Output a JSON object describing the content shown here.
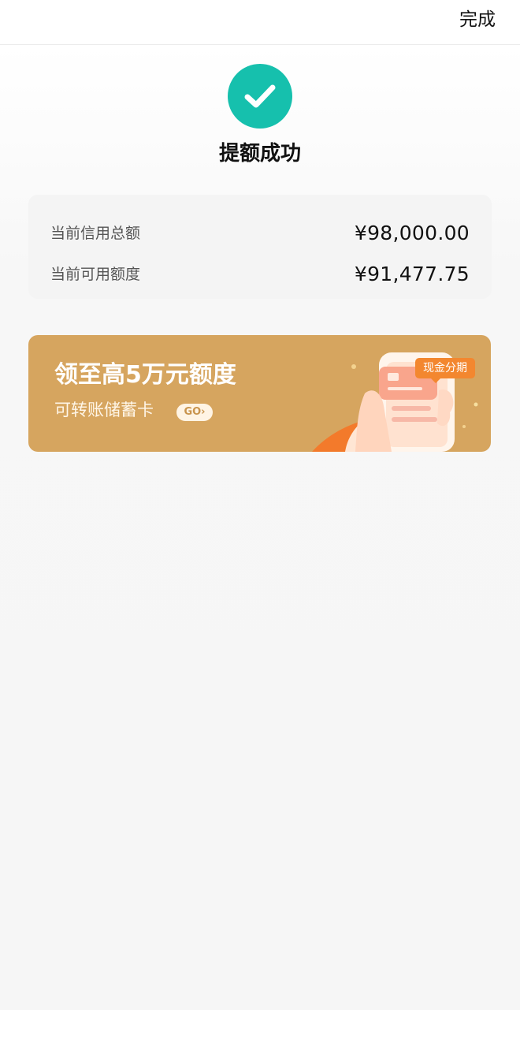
{
  "header": {
    "done_label": "完成"
  },
  "status": {
    "icon": "check-icon",
    "title": "提额成功",
    "color": "#16c0ad"
  },
  "credit": {
    "total_label": "当前信用总额",
    "total_value": "¥98,000.00",
    "available_label": "当前可用额度",
    "available_value": "¥91,477.75"
  },
  "promo": {
    "title": "领至高5万元额度",
    "subtitle": "可转账储蓄卡",
    "go_label": "GO›",
    "tag_label": "现金分期",
    "background_color": "#d6a55f",
    "tag_color": "#f3872f"
  }
}
